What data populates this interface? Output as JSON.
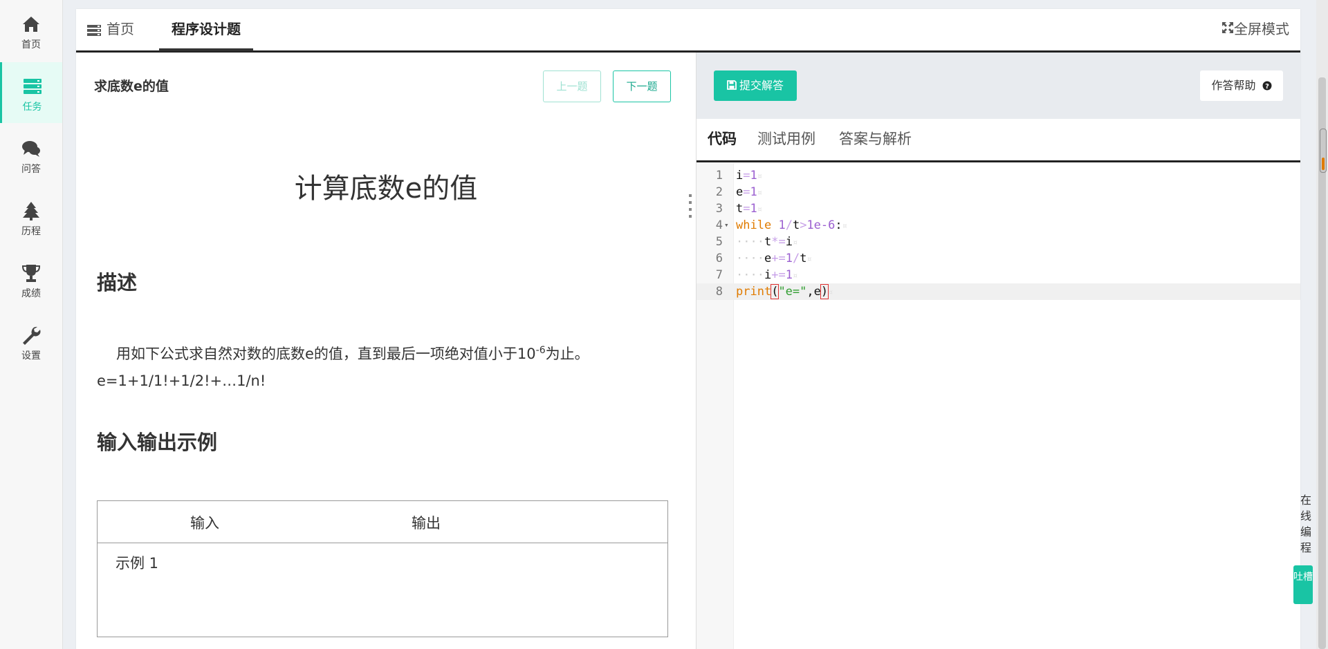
{
  "sidebar": {
    "items": [
      {
        "label": "首页",
        "icon": "home-icon"
      },
      {
        "label": "任务",
        "icon": "tasks-icon"
      },
      {
        "label": "问答",
        "icon": "comments-icon"
      },
      {
        "label": "历程",
        "icon": "tree-icon"
      },
      {
        "label": "成绩",
        "icon": "trophy-icon"
      },
      {
        "label": "设置",
        "icon": "wrench-icon"
      }
    ],
    "active": "任务"
  },
  "header": {
    "tabs": [
      {
        "label": "首页",
        "icon": "list-icon"
      },
      {
        "label": "程序设计题"
      }
    ],
    "fullscreen_label": "全屏模式"
  },
  "problem": {
    "title": "求底数e的值",
    "prev_label": "上一题",
    "next_label": "下一题",
    "heading": "计算底数e的值",
    "desc_heading": "描述",
    "desc_line1_prefix": "用如下公式求自然对数的底数e的值，直到最后一项绝对值小于10",
    "desc_line1_sup": "-6",
    "desc_line1_suffix": "为止。",
    "desc_line2": "e=1+1/1!+1/2!+…1/n!",
    "io_heading": "输入输出示例",
    "io_table": {
      "headers": [
        "输入",
        "输出"
      ],
      "rows": [
        [
          "示例 1",
          ""
        ]
      ]
    }
  },
  "editor": {
    "submit_label": "提交解答",
    "help_label": "作答帮助",
    "tabs": [
      "代码",
      "测试用例",
      "答案与解析"
    ],
    "active_tab": "代码",
    "lines": [
      "i=1",
      "e=1",
      "t=1",
      "while 1/t>1e-6:",
      "    t*=i",
      "    e+=1/t",
      "    i+=1",
      "print(\"e=\",e)"
    ]
  },
  "float": {
    "vertical_text": "在线编程",
    "button_label": "吐槽"
  },
  "colors": {
    "accent": "#19c4a4",
    "keyword": "#e07b00",
    "number": "#9b5fd0",
    "string": "#2f9d2f"
  }
}
